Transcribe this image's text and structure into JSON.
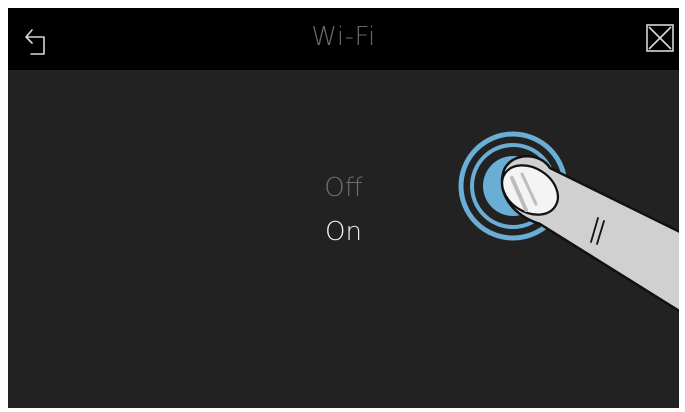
{
  "header": {
    "title": "Wi-Fi",
    "back_icon": "back-arrow-icon",
    "close_icon": "close-x-icon"
  },
  "picker": {
    "options": [
      "Off",
      "On"
    ],
    "selected": "On"
  },
  "gesture": {
    "icon": "tap-gesture-hand-icon",
    "accent_color": "#6aaed6"
  },
  "colors": {
    "background": "#222222",
    "topbar": "#000000",
    "selected_text": "#f2f2f2",
    "unselected_text": "#6e6e6e"
  }
}
